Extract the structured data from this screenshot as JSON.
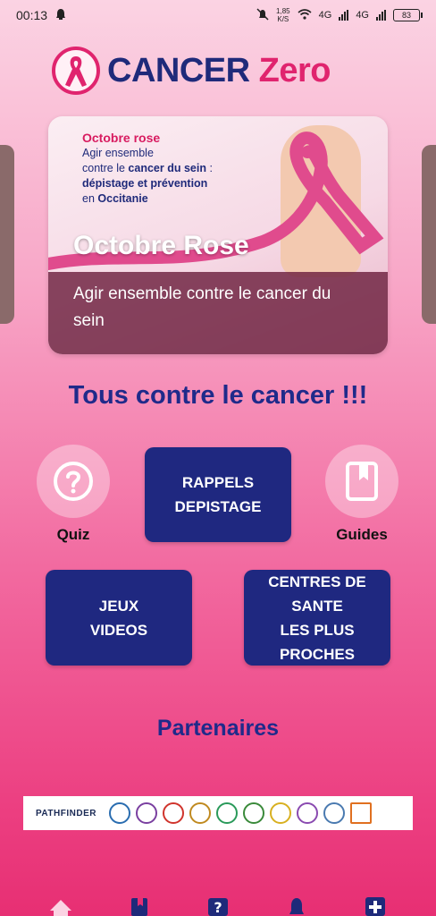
{
  "status_bar": {
    "time": "00:13",
    "net_speed_value": "1,85",
    "net_speed_unit": "K/S",
    "signal_1": "4G",
    "signal_2": "4G",
    "battery": "83"
  },
  "brand": {
    "name_part1": "CANCER",
    "name_part2": "Zero",
    "primary_color": "#1f2a7a",
    "accent_color": "#e0246e"
  },
  "hero": {
    "poster_title": "Octobre rose",
    "poster_line1": "Agir ensemble",
    "poster_line2_pre": "contre le ",
    "poster_line2_bold": "cancer du sein",
    "poster_line2_post": " :",
    "poster_line3": "dépistage et prévention",
    "poster_line4_pre": "en ",
    "poster_line4_bold": "Occitanie",
    "title": "Octobre Rose",
    "caption": "Agir ensemble contre le cancer du sein"
  },
  "slogan": "Tous contre le cancer !!!",
  "actions": {
    "quiz_label": "Quiz",
    "guides_label": "Guides",
    "rappels_line1": "RAPPELS",
    "rappels_line2": "DEPISTAGE",
    "jeux_line1": "JEUX",
    "jeux_line2": "VIDEOS",
    "centres_line1": "CENTRES DE",
    "centres_line2": "SANTE",
    "centres_line3": "LES PLUS",
    "centres_line4": "PROCHES",
    "tile_color": "#1f2880"
  },
  "partners": {
    "title": "Partenaires",
    "first_partner": "PATHFINDER"
  },
  "bottom_nav": {
    "icons": [
      "home-icon",
      "book-icon",
      "quiz-icon",
      "bell-icon",
      "plus-icon"
    ]
  }
}
